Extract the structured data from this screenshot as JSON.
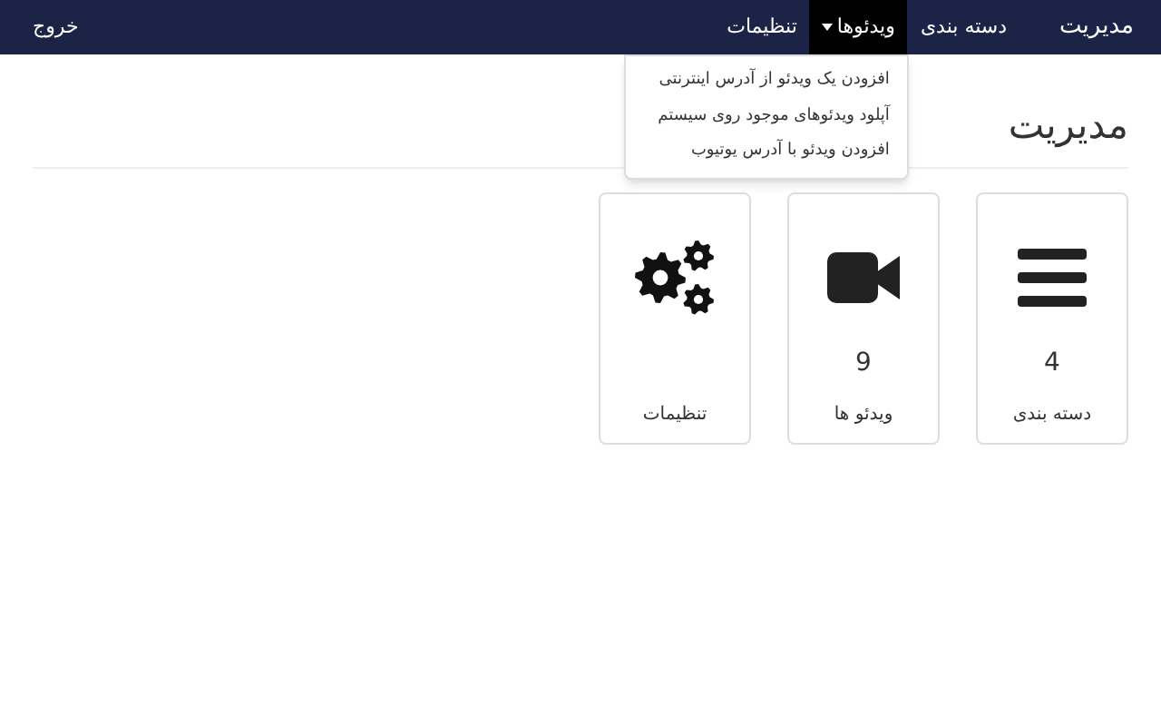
{
  "navbar": {
    "brand": "مدیریت",
    "items": [
      {
        "label": "دسته بندی",
        "selected": false,
        "dropdown": false
      },
      {
        "label": "ویدئوها",
        "selected": true,
        "dropdown": true
      },
      {
        "label": "تنظیمات",
        "selected": false,
        "dropdown": false
      }
    ],
    "logout": "خروج"
  },
  "dropdown_menu": [
    "افزودن یک ویدئو از آدرس اینترنتی",
    "آپلود ویدئوهای موجود روی سیستم",
    "افزودن ویدئو با آدرس یوتیوب"
  ],
  "heading": "مدیریت",
  "cards": [
    {
      "kind": "list",
      "count": "4",
      "label": "دسته بندی"
    },
    {
      "kind": "video",
      "count": "9",
      "label": "ویدئو ها"
    },
    {
      "kind": "gears",
      "label": "تنظیمات"
    }
  ]
}
